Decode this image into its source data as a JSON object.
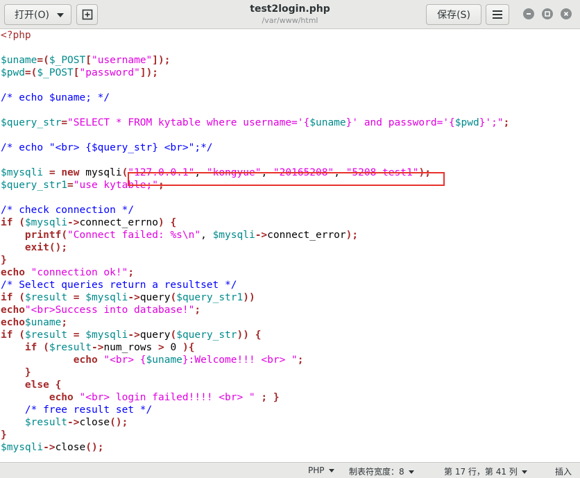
{
  "header": {
    "open_label": "打开(O)",
    "title": "test2login.php",
    "path": "/var/www/html",
    "save_label": "保存(S)"
  },
  "icons": {
    "open_dropdown": "chevron-down-icon",
    "new_tab": "new-tab-icon",
    "menu": "hamburger-menu-icon",
    "minimize": "minimize-icon",
    "maximize": "maximize-icon",
    "close": "close-icon"
  },
  "colors": {
    "keyword": "#a52a2a",
    "variable": "#008a8c",
    "string": "#e000e0",
    "comment": "#0000ff",
    "highlight_box": "#e8312b"
  },
  "code_lines": [
    "<?php",
    "",
    "$uname=($_POST[\"username\"]);",
    "$pwd=($_POST[\"password\"]);",
    "",
    "/* echo $uname; */",
    "",
    "$query_str=\"SELECT * FROM kytable where username='{$uname}' and password='{$pwd}';\";",
    "",
    "/* echo \"<br> {$query_str} <br>\";*/",
    "",
    "$mysqli = new mysqli(\"127.0.0.1\", \"kongyue\", \"20165208\", \"5208 test1\");",
    "$query_str1=\"use kytable;\";",
    "",
    "/* check connection */",
    "if ($mysqli->connect_errno) {",
    "    printf(\"Connect failed: %s\\n\", $mysqli->connect_error);",
    "    exit();",
    "}",
    "echo \"connection ok!\";",
    "/* Select queries return a resultset */",
    "if ($result = $mysqli->query($query_str1))",
    "echo\"<br>Success into database!\";",
    "echo$uname;",
    "if ($result = $mysqli->query($query_str)) {",
    "    if ($result->num_rows > 0 ){",
    "            echo \"<br> {$uname}:Welcome!!! <br> \";",
    "    }",
    "    else {",
    "        echo \"<br> login failed!!!! <br> \" ; }",
    "    /* free result set */",
    "    $result->close();",
    "}",
    "$mysqli->close();"
  ],
  "statusbar": {
    "language": "PHP",
    "tab_width": "制表符宽度：8",
    "position": "第 17 行，第 41 列",
    "mode": "插入"
  }
}
